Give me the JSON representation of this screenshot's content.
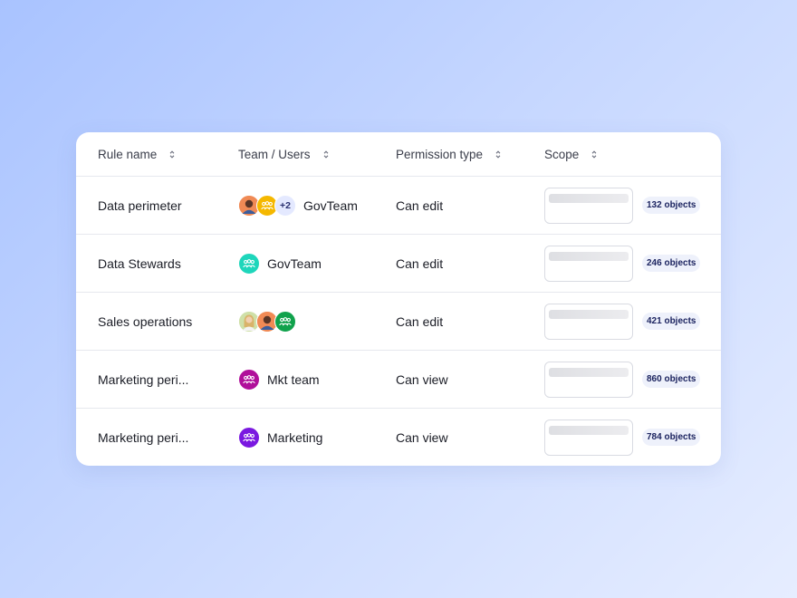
{
  "table": {
    "headers": {
      "rule_name": "Rule name",
      "team_users": "Team / Users",
      "permission_type": "Permission type",
      "scope": "Scope"
    },
    "rows": [
      {
        "rule_name": "Data perimeter",
        "avatars": [
          "person-avatar-1",
          "group-avatar-yellow"
        ],
        "more_count": "+2",
        "team": "GovTeam",
        "permission": "Can edit",
        "objects": "132 objects"
      },
      {
        "rule_name": "Data Stewards",
        "avatars": [
          "group-avatar-teal"
        ],
        "team": "GovTeam",
        "permission": "Can edit",
        "objects": "246 objects"
      },
      {
        "rule_name": "Sales operations",
        "avatars": [
          "person-avatar-2",
          "person-avatar-3",
          "group-avatar-green"
        ],
        "team": "",
        "permission": "Can edit",
        "objects": "421 objects"
      },
      {
        "rule_name": "Marketing peri...",
        "avatars": [
          "group-avatar-magenta"
        ],
        "team": "Mkt team",
        "permission": "Can view",
        "objects": "860 objects"
      },
      {
        "rule_name": "Marketing peri...",
        "avatars": [
          "group-avatar-purple"
        ],
        "team": "Marketing",
        "permission": "Can view",
        "objects": "784 objects"
      }
    ]
  },
  "colors": {
    "teal": "#1ed6bb",
    "yellow": "#f5b800",
    "green": "#10a24c",
    "magenta": "#b0109a",
    "purple": "#7a18e0",
    "badge_bg": "#eef1fb",
    "badge_text": "#1c2460"
  }
}
